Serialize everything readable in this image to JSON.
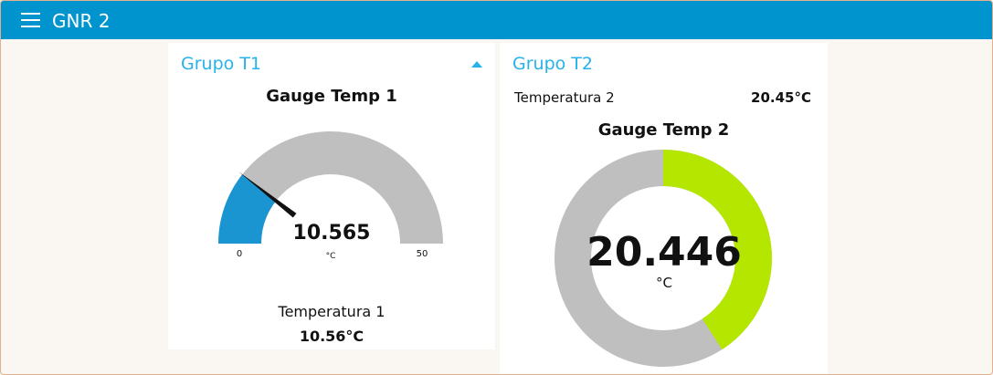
{
  "app": {
    "title": "GNR 2"
  },
  "colors": {
    "header": "#0094ce",
    "group_title": "#26b2ea",
    "gauge1_fill": "#1b95d1",
    "gauge_track": "#bfbfbf",
    "donut_fill": "#b4e600"
  },
  "group1": {
    "title": "Grupo T1",
    "collapse_icon": "chevron-up-icon",
    "gauge": {
      "title": "Gauge Temp 1",
      "value": "10.565",
      "unit": "°C",
      "min": "0",
      "max": "50",
      "numeric_value": 10.565,
      "numeric_min": 0,
      "numeric_max": 50
    },
    "text": {
      "label": "Temperatura 1",
      "value": "10.56°C"
    }
  },
  "group2": {
    "title": "Grupo T2",
    "text": {
      "label": "Temperatura 2",
      "value": "20.45°C"
    },
    "gauge": {
      "title": "Gauge Temp 2",
      "value": "20.446",
      "unit": "°C",
      "numeric_value": 20.446,
      "numeric_min": 0,
      "numeric_max": 50
    }
  }
}
